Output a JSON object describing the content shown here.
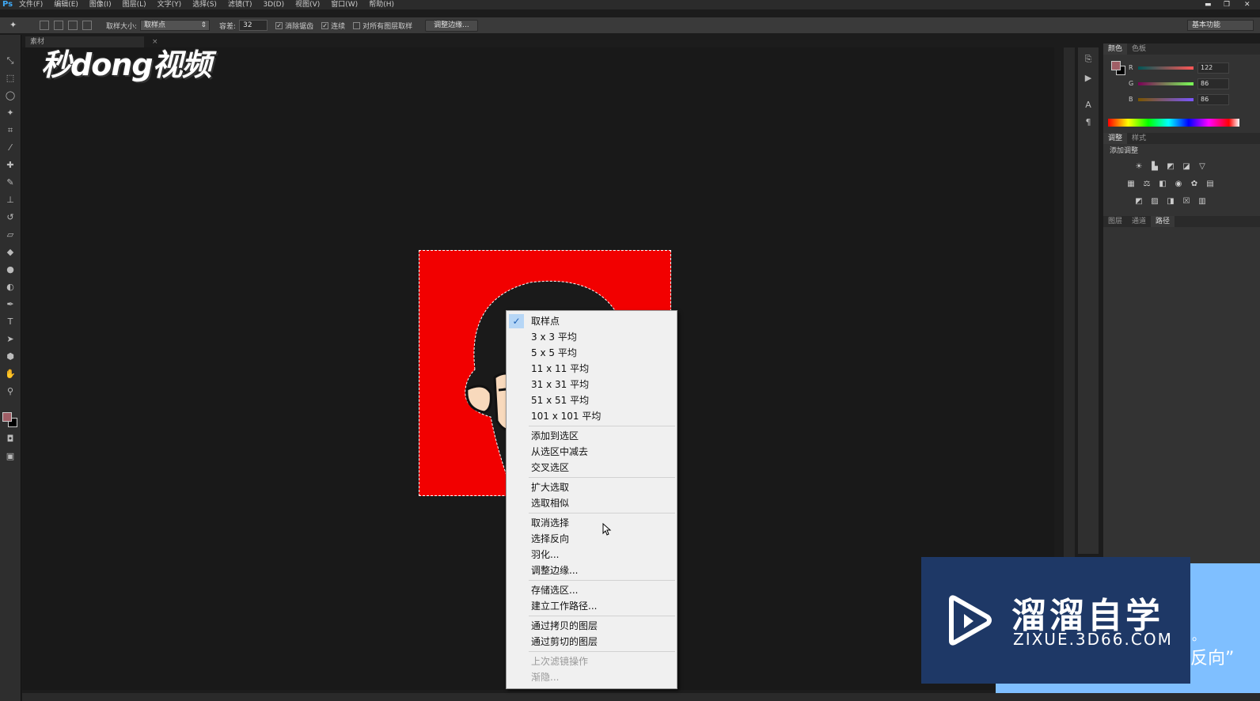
{
  "app": {
    "logo": "Ps"
  },
  "menubar": {
    "items": [
      "文件(F)",
      "编辑(E)",
      "图像(I)",
      "图层(L)",
      "文字(Y)",
      "选择(S)",
      "滤镜(T)",
      "3D(D)",
      "视图(V)",
      "窗口(W)",
      "帮助(H)"
    ]
  },
  "options_bar": {
    "sample_size_label": "取样大小:",
    "sample_size_value": "取样点",
    "tolerance_label": "容差:",
    "tolerance_value": "32",
    "antialias_label": "消除锯齿",
    "contiguous_label": "连续",
    "sample_all_label": "对所有图层取样",
    "refine_edge_button": "调整边缘...",
    "workspace": "基本功能"
  },
  "document": {
    "tab_label": "素材"
  },
  "color_panel": {
    "tabs": [
      "颜色",
      "色板"
    ],
    "r_label": "R",
    "r_value": "122",
    "g_label": "G",
    "g_value": "86",
    "b_label": "B",
    "b_value": "86"
  },
  "adjust_panel": {
    "tabs": [
      "调整",
      "样式"
    ],
    "title": "添加调整"
  },
  "layers_panel": {
    "tabs": [
      "图层",
      "通道",
      "路径"
    ]
  },
  "context_menu": {
    "items": [
      {
        "label": "取样点",
        "checked": true
      },
      {
        "label": "3 x 3 平均"
      },
      {
        "label": "5 x 5 平均"
      },
      {
        "label": "11 x 11 平均"
      },
      {
        "label": "31 x 31 平均"
      },
      {
        "label": "51 x 51 平均"
      },
      {
        "label": "101 x 101 平均"
      },
      {
        "label": "添加到选区"
      },
      {
        "label": "从选区中减去"
      },
      {
        "label": "交叉选区"
      },
      {
        "label": "扩大选取"
      },
      {
        "label": "选取相似"
      },
      {
        "label": "取消选择"
      },
      {
        "label": "选择反向"
      },
      {
        "label": "羽化..."
      },
      {
        "label": "调整边缘..."
      },
      {
        "label": "存储选区..."
      },
      {
        "label": "建立工作路径..."
      },
      {
        "label": "通过拷贝的图层"
      },
      {
        "label": "通过剪切的图层"
      },
      {
        "label": "上次滤镜操作",
        "disabled": true
      },
      {
        "label": "渐隐...",
        "disabled": true
      }
    ]
  },
  "watermarks": {
    "top_left": "秒dong视频",
    "brand_cn": "溜溜自学",
    "brand_en": "ZIXUE.3D66.COM",
    "subtitle": "反向”",
    "subtitle_dot": "。"
  },
  "colors": {
    "canvas_red": "#f20000",
    "fg_swatch": "#a05e66",
    "brand_blue": "#1e3866"
  }
}
